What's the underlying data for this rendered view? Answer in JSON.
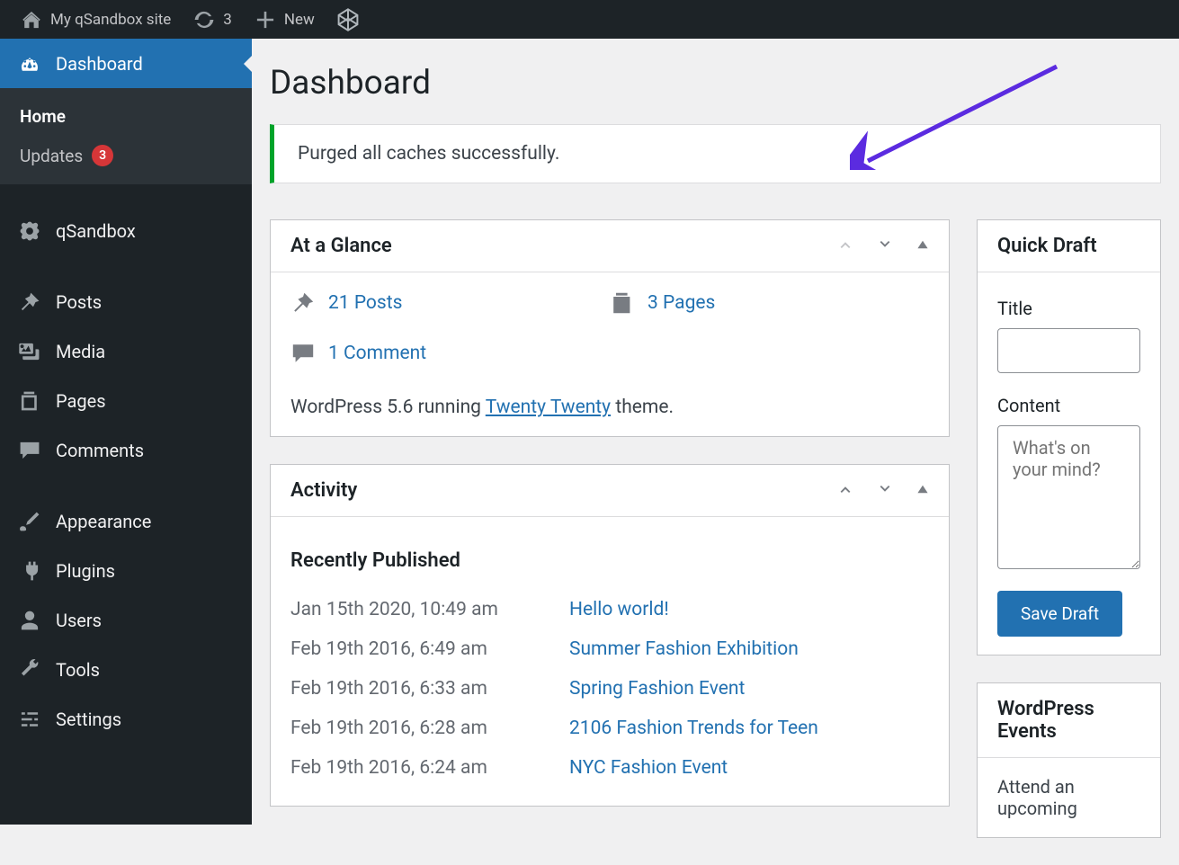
{
  "topbar": {
    "site_name": "My qSandbox site",
    "cache_count": "3",
    "new_label": "New"
  },
  "sidebar": {
    "dashboard": "Dashboard",
    "home": "Home",
    "updates": "Updates",
    "updates_count": "3",
    "qsandbox": "qSandbox",
    "posts": "Posts",
    "media": "Media",
    "pages": "Pages",
    "comments": "Comments",
    "appearance": "Appearance",
    "plugins": "Plugins",
    "users": "Users",
    "tools": "Tools",
    "settings": "Settings"
  },
  "page": {
    "title": "Dashboard",
    "notice": "Purged all caches successfully."
  },
  "glance": {
    "title": "At a Glance",
    "posts": "21 Posts",
    "pages": "3 Pages",
    "comments": "1 Comment",
    "running_prefix": "WordPress 5.6 running ",
    "theme": "Twenty Twenty",
    "running_suffix": " theme."
  },
  "activity": {
    "title": "Activity",
    "subtitle": "Recently Published",
    "rows": [
      {
        "date": "Jan 15th 2020, 10:49 am",
        "title": "Hello world!"
      },
      {
        "date": "Feb 19th 2016, 6:49 am",
        "title": "Summer Fashion Exhibition"
      },
      {
        "date": "Feb 19th 2016, 6:33 am",
        "title": "Spring Fashion Event"
      },
      {
        "date": "Feb 19th 2016, 6:28 am",
        "title": "2106 Fashion Trends for Teen"
      },
      {
        "date": "Feb 19th 2016, 6:24 am",
        "title": "NYC Fashion Event"
      }
    ]
  },
  "quickdraft": {
    "title": "Quick Draft",
    "title_label": "Title",
    "content_label": "Content",
    "content_placeholder": "What's on your mind?",
    "save": "Save Draft"
  },
  "events": {
    "title": "WordPress Events",
    "text": "Attend an upcoming"
  }
}
